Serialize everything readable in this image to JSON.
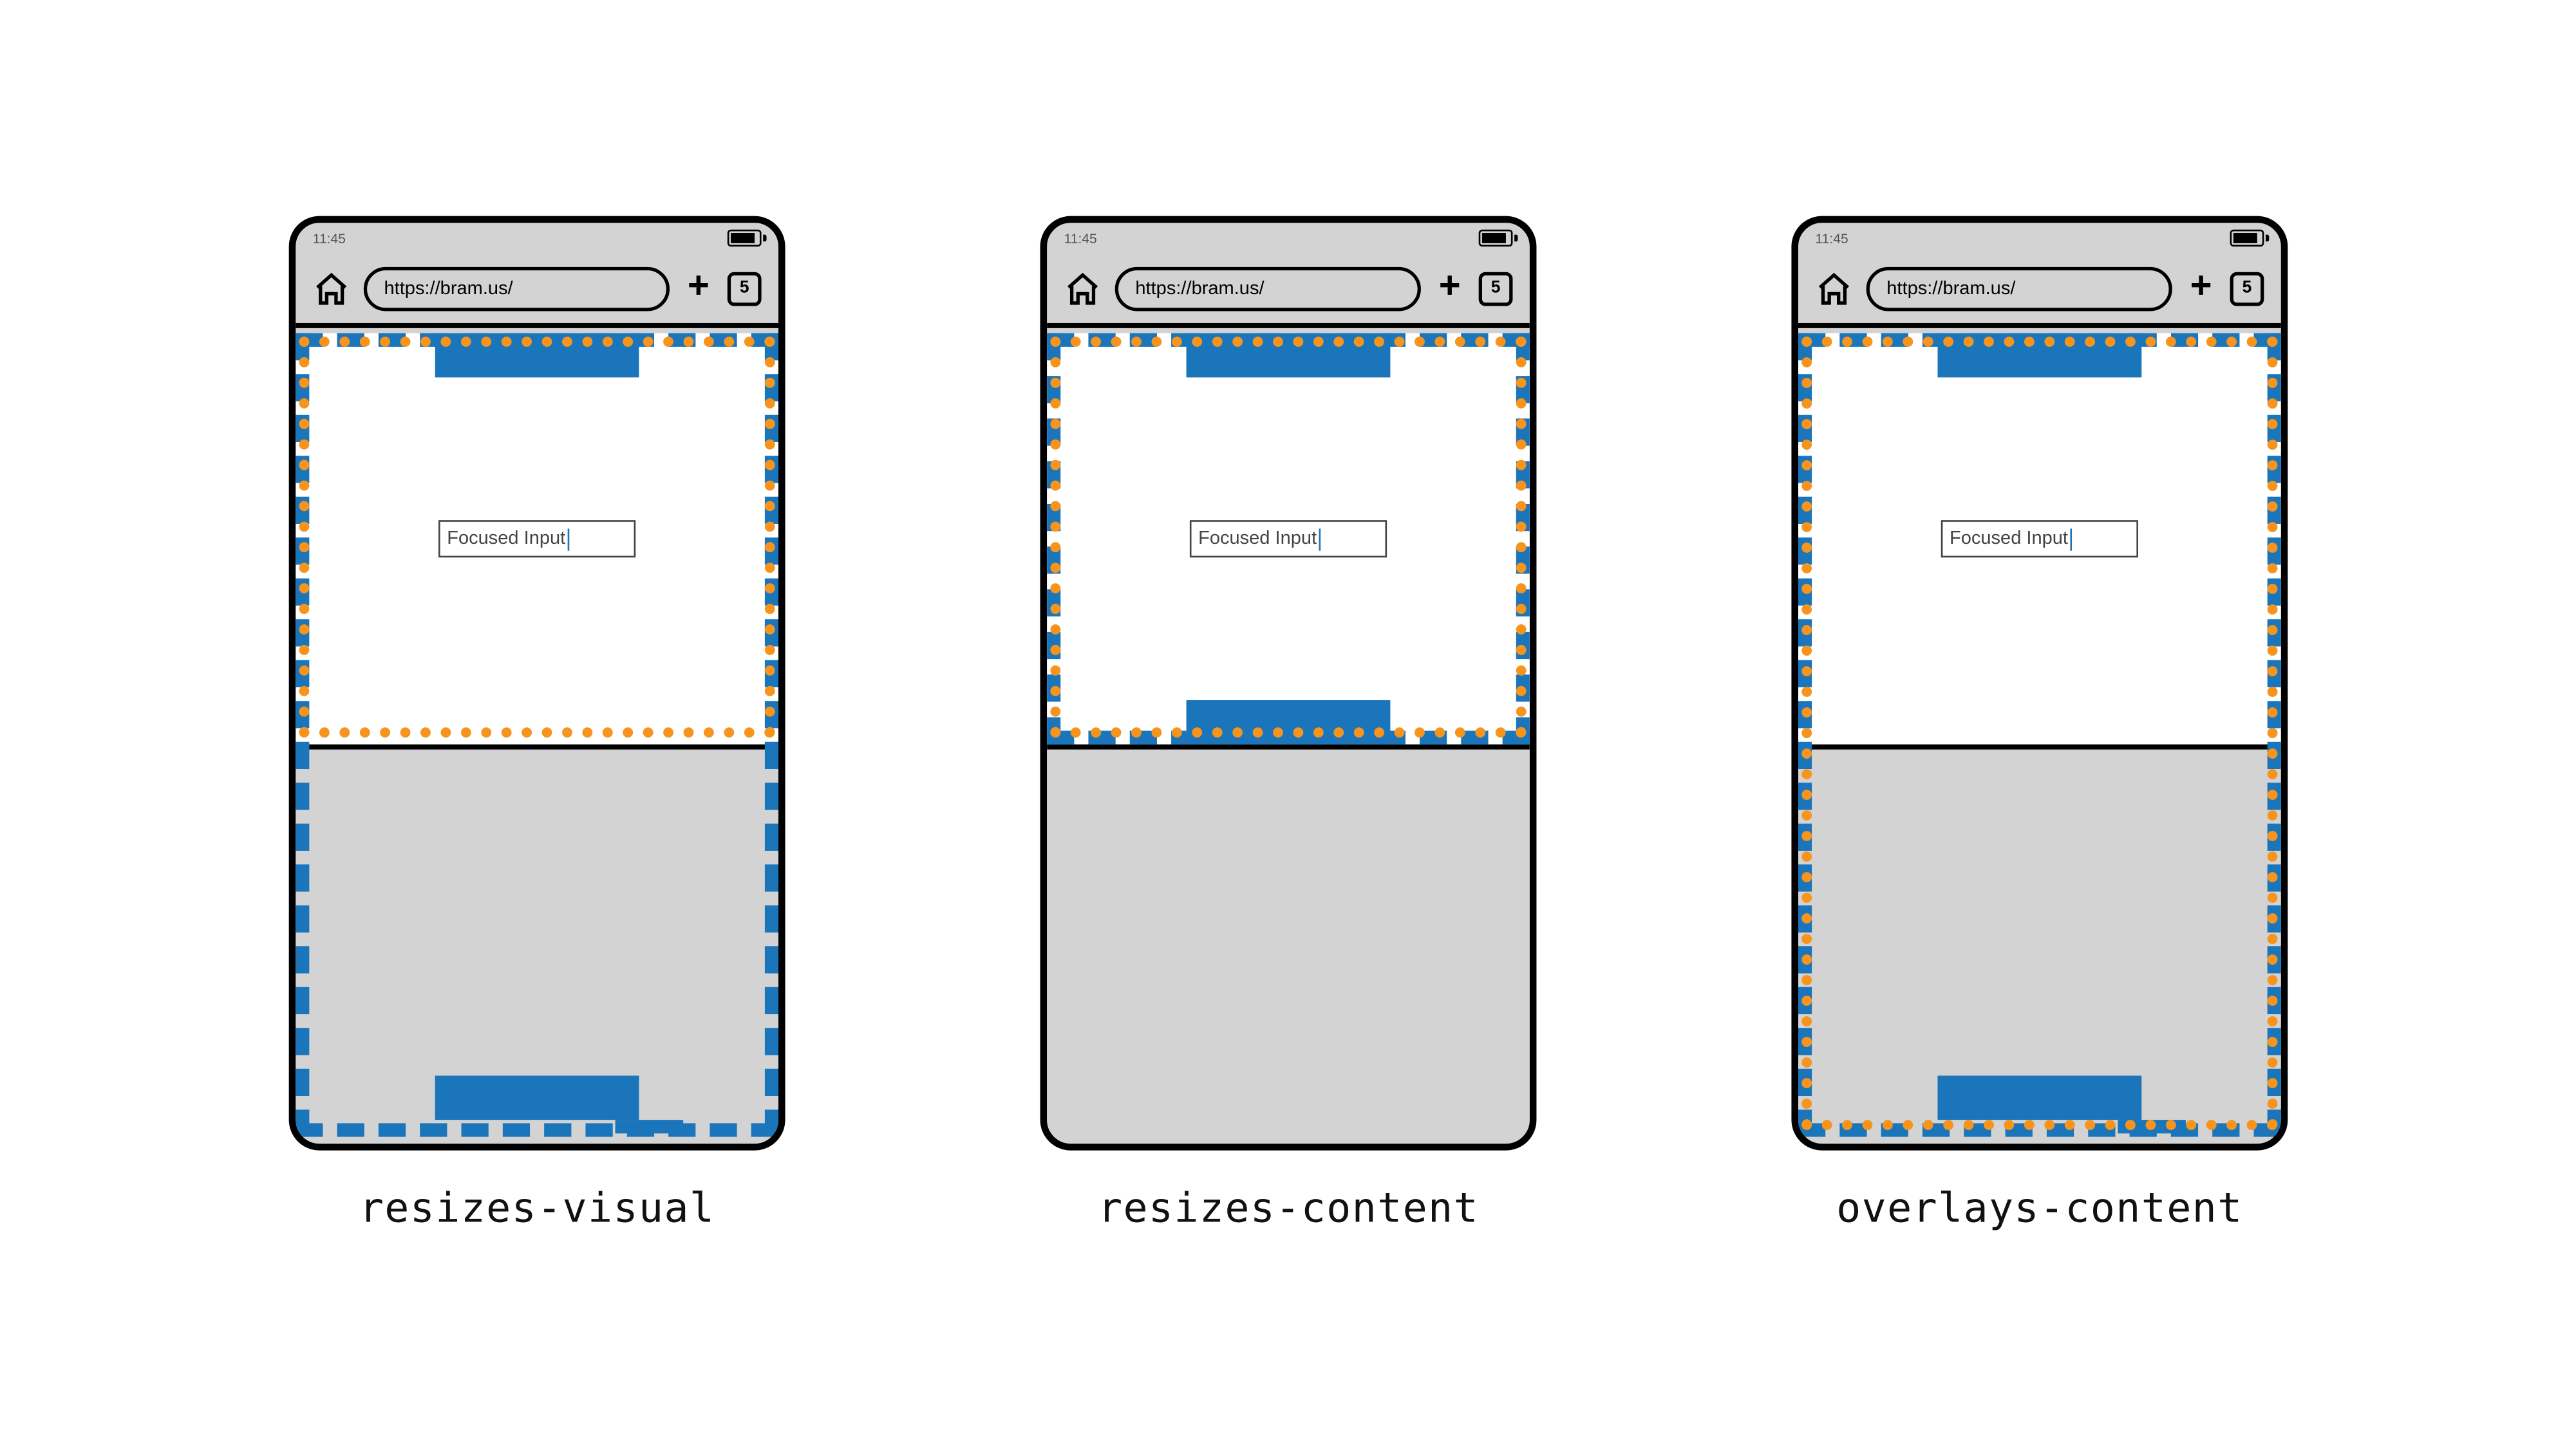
{
  "status": {
    "time": "11:45"
  },
  "urlbar": {
    "url": "https://bram.us/",
    "tab_count": "5"
  },
  "input": {
    "label": "Focused Input"
  },
  "captions": {
    "resizes_visual": "resizes-visual",
    "resizes_content": "resizes-content",
    "overlays_content": "overlays-content"
  }
}
